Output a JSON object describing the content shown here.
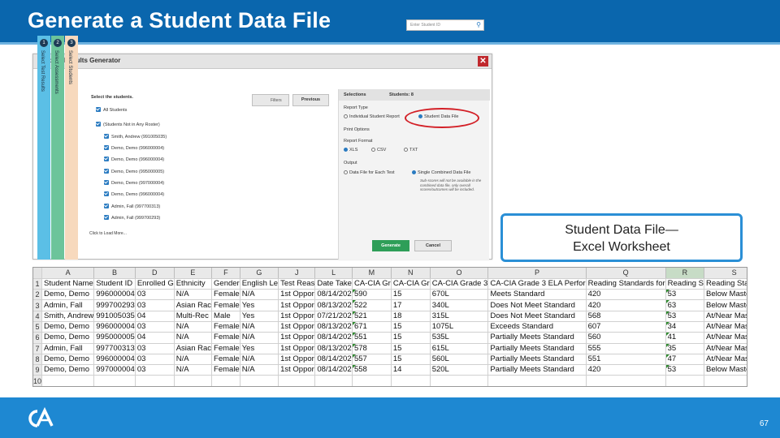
{
  "header": {
    "title": "Generate a Student Data File"
  },
  "dialog": {
    "title": "Student Results Generator",
    "close_glyph": "✕",
    "search_placeholder": "Enter Student ID",
    "steps": [
      {
        "num": "1",
        "label": "Select Test Results"
      },
      {
        "num": "2",
        "label": "Select Assessments"
      },
      {
        "num": "3",
        "label": "Select Students"
      }
    ],
    "students_heading": "Select the students.",
    "filter_label": "Filters",
    "previous_label": "Previous",
    "students": [
      "All Students",
      "(Students Not in Any Roster)",
      "Smith, Andrew (991005035)",
      "Demo, Demo (996000004)",
      "Demo, Demo (996000004)",
      "Demo, Demo (995000005)",
      "Demo, Demo (997000004)",
      "Demo, Demo (996000004)",
      "Admin, Fall (997700313)",
      "Admin, Fall (999700293)"
    ],
    "load_more": "Click to Load More...",
    "selections": {
      "title": "Selections",
      "count": "Students: 8",
      "report_type_label": "Report Type",
      "report_individual": "Individual Student Report",
      "report_data_file": "Student Data File",
      "print_options_label": "Print Options",
      "format_label": "Report Format",
      "format_xls": "XLS",
      "format_csv": "CSV",
      "format_txt": "TXT",
      "output_label": "Output",
      "output_each": "Data File for Each Test",
      "output_combined": "Single Combined Data File",
      "output_note": "Sub-scores will not be available in the combined data file, only overall scores/outcomes will be included."
    },
    "generate_label": "Generate",
    "cancel_label": "Cancel"
  },
  "callout": {
    "line1": "Student Data File—",
    "line2": "Excel Worksheet"
  },
  "sheet": {
    "col_letters": [
      "A",
      "B",
      "D",
      "E",
      "F",
      "G",
      "J",
      "L",
      "M",
      "N",
      "O",
      "P",
      "Q",
      "R",
      "S"
    ],
    "rows": [
      [
        "Student Name",
        "Student ID",
        "Enrolled G",
        "Ethnicity",
        "Gender",
        "English Le",
        "Test Reas",
        "Date Take",
        "CA-CIA Gr",
        "CA-CIA Gr",
        "CA-CIA Grade 3",
        "CA-CIA Grade 3 ELA Perfor",
        "Reading Standards for",
        "Reading S",
        "Reading Standar"
      ],
      [
        "Demo, Demo",
        "996000004",
        "03",
        "N/A",
        "Female",
        "N/A",
        "1st Oppor",
        "08/14/202",
        "590",
        "15",
        "670L",
        "Meets Standard",
        "420",
        "53",
        "Below Mastery"
      ],
      [
        "Admin, Fall",
        "999700293",
        "03",
        "Asian Rac",
        "Female",
        "Yes",
        "1st Oppor",
        "08/13/202",
        "522",
        "17",
        "340L",
        "Does Not Meet Standard",
        "420",
        "63",
        "Below Mastery"
      ],
      [
        "Smith, Andrew",
        "991005035",
        "04",
        "Multi-Rec",
        "Male",
        "Yes",
        "1st Oppor",
        "07/21/202",
        "521",
        "18",
        "315L",
        "Does Not Meet Standard",
        "568",
        "53",
        "At/Near Mastery"
      ],
      [
        "Demo, Demo",
        "996000004",
        "03",
        "N/A",
        "Female",
        "N/A",
        "1st Oppor",
        "08/13/202",
        "671",
        "15",
        "1075L",
        "Exceeds Standard",
        "607",
        "34",
        "At/Near Mastery"
      ],
      [
        "Demo, Demo",
        "995000005",
        "04",
        "N/A",
        "Female",
        "N/A",
        "1st Oppor",
        "08/14/202",
        "551",
        "15",
        "535L",
        "Partially Meets Standard",
        "560",
        "41",
        "At/Near Mastery"
      ],
      [
        "Admin, Fall",
        "997700313",
        "03",
        "Asian Rac",
        "Female",
        "Yes",
        "1st Oppor",
        "08/13/202",
        "578",
        "15",
        "615L",
        "Partially Meets Standard",
        "555",
        "35",
        "At/Near Mastery"
      ],
      [
        "Demo, Demo",
        "996000004",
        "03",
        "N/A",
        "Female",
        "N/A",
        "1st Oppor",
        "08/14/202",
        "557",
        "15",
        "560L",
        "Partially Meets Standard",
        "551",
        "47",
        "At/Near Mastery"
      ],
      [
        "Demo, Demo",
        "997000004",
        "03",
        "N/A",
        "Female",
        "N/A",
        "1st Oppor",
        "08/14/202",
        "558",
        "14",
        "520L",
        "Partially Meets Standard",
        "420",
        "53",
        "Below Mastery"
      ],
      [
        "",
        "",
        "",
        "",
        "",
        "",
        "",
        "",
        "",
        "",
        "",
        "",
        "",
        "",
        ""
      ]
    ]
  },
  "footer": {
    "page_number": "67"
  }
}
